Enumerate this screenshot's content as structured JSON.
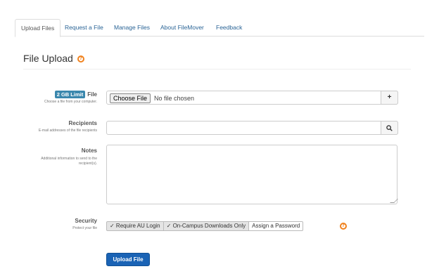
{
  "tabs": [
    {
      "label": "Upload Files",
      "active": true
    },
    {
      "label": "Request a File",
      "active": false
    },
    {
      "label": "Manage Files",
      "active": false
    },
    {
      "label": "About FileMover",
      "active": false
    },
    {
      "label": "Feedback",
      "active": false
    }
  ],
  "page": {
    "title": "File Upload",
    "help_icon": "question-circle-icon"
  },
  "form": {
    "file": {
      "badge": "2 GB Limit",
      "label": "File",
      "help": "Choose a file from your computer.",
      "button_label": "Choose File",
      "status": "No file chosen",
      "add_icon": "plus-icon",
      "add_symbol": "+"
    },
    "recipients": {
      "label": "Recipients",
      "help": "E-mail addresses of the file recipients",
      "value": "",
      "search_icon": "search-icon"
    },
    "notes": {
      "label": "Notes",
      "help_line1": "Additional information to send to the",
      "help_line2": "recipient(s).",
      "value": ""
    },
    "security": {
      "label": "Security",
      "help": "Protect your file",
      "options": [
        {
          "label": "✓ Require AU Login",
          "selected": true
        },
        {
          "label": "✓ On-Campus Downloads Only",
          "selected": true
        },
        {
          "label": "Assign a Password",
          "selected": false
        }
      ],
      "help_icon": "question-circle-icon"
    },
    "submit_label": "Upload File"
  },
  "colors": {
    "accent": "#f0821e",
    "primary": "#1a63b5",
    "badge": "#3a87ad",
    "link": "#2a6496"
  }
}
